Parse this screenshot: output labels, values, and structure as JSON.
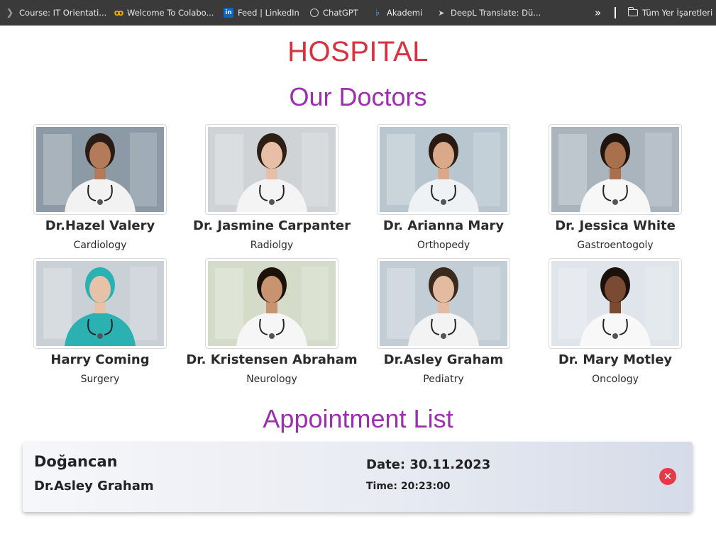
{
  "bookmarks": {
    "items": [
      {
        "label": "Course: IT Orientati...",
        "icon": "course-icon"
      },
      {
        "label": "Welcome To Colabo...",
        "icon": "colab-icon"
      },
      {
        "label": "Feed | LinkedIn",
        "icon": "linkedin-icon"
      },
      {
        "label": "ChatGPT",
        "icon": "chatgpt-icon"
      },
      {
        "label": "Akademi",
        "icon": "akademi-icon"
      },
      {
        "label": "DeepL Translate: Dü...",
        "icon": "deepl-icon"
      }
    ],
    "overflow_symbol": "»",
    "all_bookmarks_label": "Tüm Yer İşaretleri"
  },
  "page": {
    "title": "HOSPITAL",
    "doctors_heading": "Our Doctors",
    "appointments_heading": "Appointment List"
  },
  "doctors": [
    {
      "name": "Dr.Hazel Valery",
      "department": "Cardiology",
      "bg": "#8c9aa6",
      "coat": "#f2f2f2",
      "skin": "#b47b5a",
      "hair": "#2a1c14"
    },
    {
      "name": "Dr. Jasmine Carpanter",
      "department": "Radiolgy",
      "bg": "#cfd3d6",
      "coat": "#f4f4f4",
      "skin": "#e6bfa6",
      "hair": "#2d1e16"
    },
    {
      "name": "Dr. Arianna Mary",
      "department": "Orthopedy",
      "bg": "#b8c6cf",
      "coat": "#eef2f5",
      "skin": "#d9a98a",
      "hair": "#2a1a12"
    },
    {
      "name": "Dr. Jessica White",
      "department": "Gastroentogoly",
      "bg": "#a9b4bd",
      "coat": "#f7f7f7",
      "skin": "#a8704d",
      "hair": "#1f140e"
    },
    {
      "name": "Harry Coming",
      "department": "Surgery",
      "bg": "#c9d0d6",
      "coat": "#2bb1b1",
      "skin": "#e7c2a8",
      "hair": "#2bb1b1"
    },
    {
      "name": "Dr. Kristensen Abraham",
      "department": "Neurology",
      "bg": "#d4dcc9",
      "coat": "#f6f6f6",
      "skin": "#c8936f",
      "hair": "#1b120c"
    },
    {
      "name": "Dr.Asley Graham",
      "department": "Pediatry",
      "bg": "#c3cdd6",
      "coat": "#f3f3f3",
      "skin": "#e3bba0",
      "hair": "#3a2a1e"
    },
    {
      "name": "Dr. Mary Motley",
      "department": "Oncology",
      "bg": "#dfe5ea",
      "coat": "#f8f8f8",
      "skin": "#7a4a33",
      "hair": "#1a110b"
    }
  ],
  "appointments": [
    {
      "patient": "Doğancan",
      "doctor": "Dr.Asley Graham",
      "date_text": "Date: 30.11.2023",
      "time_text": "Time: 20:23:00"
    }
  ],
  "colors": {
    "title": "#d7323e",
    "heading": "#9b2fae",
    "delete_button": "#e63946"
  }
}
